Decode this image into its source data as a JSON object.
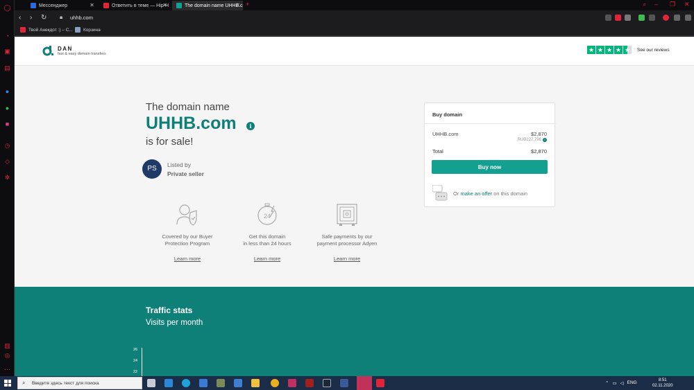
{
  "browser": {
    "tabs": [
      {
        "label": "Мессенджер",
        "favicon_color": "#2a6ad9",
        "active": false
      },
      {
        "label": "Ответить в теме — Hip-H",
        "favicon_color": "#e0243a",
        "active": false
      },
      {
        "label": "The domain name UHHB.c",
        "favicon_color": "#14a090",
        "active": true
      }
    ],
    "new_tab": "+",
    "url": "uhhb.com",
    "bookmarks": [
      {
        "label": "Твой Анекдот :) – С...",
        "favicon_color": "#e0243a"
      },
      {
        "label": "Корзина",
        "favicon_color": "#8aa0c0"
      }
    ],
    "accent": "#e0243a"
  },
  "site": {
    "logo_name": "DAN",
    "logo_tagline": "fast & easy domain transfers",
    "reviews_link": "See our reviews",
    "trust_stars": 4.5,
    "brand_color": "#0f8078"
  },
  "hero": {
    "line1": "The domain name",
    "domain": "UHHB.com",
    "line3": "is for sale!",
    "info_icon": "i",
    "avatar_initials": "PS",
    "listed_by": "Listed by",
    "seller": "Private seller"
  },
  "features": [
    {
      "icon": "shield-user-icon",
      "line1": "Covered by our Buyer",
      "line2": "Protection Program",
      "link": "Learn more"
    },
    {
      "icon": "24-hours-icon",
      "line1": "Get this domain",
      "line2": "in less than 24 hours",
      "link": "Learn more"
    },
    {
      "icon": "safe-payment-icon",
      "line1": "Safe payments by our",
      "line2": "payment processor Adyen",
      "link": "Learn more"
    }
  ],
  "buy": {
    "title": "Buy domain",
    "item": "UHHB.com",
    "price": "$2,870",
    "price_rub": "RUB227,796",
    "total_label": "Total",
    "total": "$2,870",
    "button": "Buy now",
    "offer_prefix": "Or",
    "offer_link": "make an offer",
    "offer_suffix": "on this domain"
  },
  "traffic": {
    "title": "Traffic stats",
    "subtitle": "Visits per month",
    "y_ticks": [
      "26",
      "24",
      "22"
    ]
  },
  "taskbar": {
    "search_placeholder": "Введите здесь текст для поиска",
    "lang": "ENG",
    "time": "8:51",
    "date": "02.11.2020"
  }
}
